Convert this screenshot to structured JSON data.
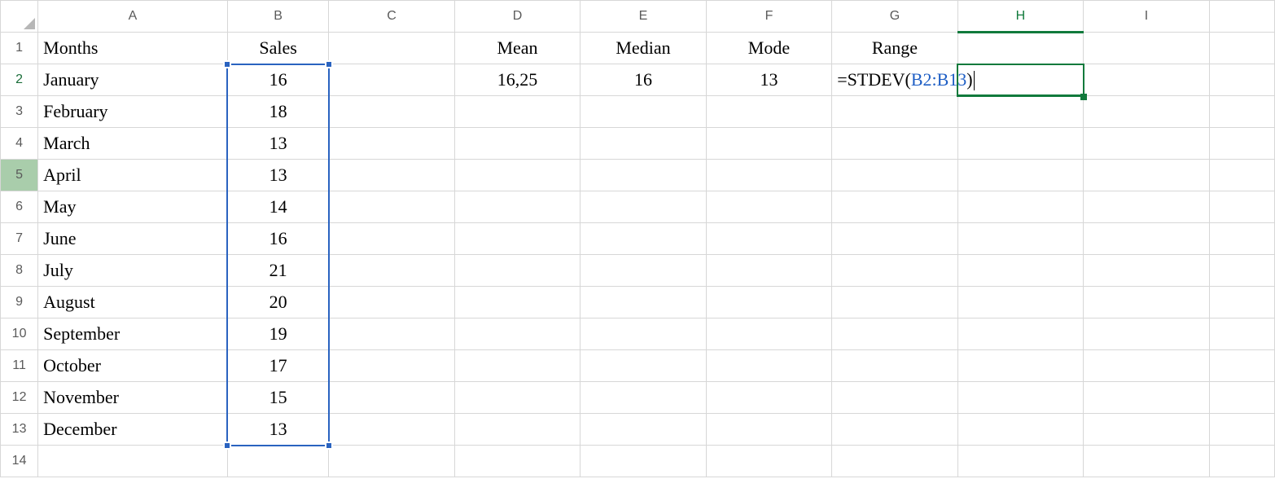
{
  "columns": [
    "A",
    "B",
    "C",
    "D",
    "E",
    "F",
    "G",
    "H",
    "I",
    ""
  ],
  "col_classes": [
    "cA",
    "cB",
    "cC",
    "cD",
    "cE",
    "cF",
    "cG",
    "cH",
    "cI",
    "cJ"
  ],
  "rows": [
    {
      "n": "1",
      "hdr_cls": "",
      "cells": [
        {
          "t": "Months",
          "cls": "left bold"
        },
        {
          "t": "Sales",
          "cls": "center bold"
        },
        {
          "t": "",
          "cls": ""
        },
        {
          "t": "Mean",
          "cls": "center bold"
        },
        {
          "t": "Median",
          "cls": "center bold"
        },
        {
          "t": "Mode",
          "cls": "center bold"
        },
        {
          "t": "Range",
          "cls": "center bold"
        },
        {
          "t": "",
          "cls": ""
        },
        {
          "t": "",
          "cls": ""
        },
        {
          "t": "",
          "cls": ""
        }
      ]
    },
    {
      "n": "2",
      "hdr_cls": "active-row-marker",
      "cells": [
        {
          "t": "January",
          "cls": "left"
        },
        {
          "t": "16",
          "cls": "center range-fill"
        },
        {
          "t": "",
          "cls": ""
        },
        {
          "t": "16,25",
          "cls": "center"
        },
        {
          "t": "16",
          "cls": "center"
        },
        {
          "t": "13",
          "cls": "center"
        },
        {
          "t": "",
          "cls": "",
          "formula": true
        },
        {
          "t": "",
          "cls": ""
        },
        {
          "t": "",
          "cls": ""
        },
        {
          "t": "",
          "cls": ""
        }
      ]
    },
    {
      "n": "3",
      "hdr_cls": "",
      "cells": [
        {
          "t": "February",
          "cls": "left"
        },
        {
          "t": "18",
          "cls": "center range-fill"
        },
        {
          "t": "",
          "cls": ""
        },
        {
          "t": "",
          "cls": ""
        },
        {
          "t": "",
          "cls": ""
        },
        {
          "t": "",
          "cls": ""
        },
        {
          "t": "",
          "cls": ""
        },
        {
          "t": "",
          "cls": ""
        },
        {
          "t": "",
          "cls": ""
        },
        {
          "t": "",
          "cls": ""
        }
      ]
    },
    {
      "n": "4",
      "hdr_cls": "",
      "cells": [
        {
          "t": "March",
          "cls": "left"
        },
        {
          "t": "13",
          "cls": "center range-fill"
        },
        {
          "t": "",
          "cls": ""
        },
        {
          "t": "",
          "cls": ""
        },
        {
          "t": "",
          "cls": ""
        },
        {
          "t": "",
          "cls": ""
        },
        {
          "t": "",
          "cls": ""
        },
        {
          "t": "",
          "cls": ""
        },
        {
          "t": "",
          "cls": ""
        },
        {
          "t": "",
          "cls": ""
        }
      ]
    },
    {
      "n": "5",
      "hdr_cls": "involved",
      "cells": [
        {
          "t": "April",
          "cls": "left"
        },
        {
          "t": "13",
          "cls": "center range-fill"
        },
        {
          "t": "",
          "cls": ""
        },
        {
          "t": "",
          "cls": ""
        },
        {
          "t": "",
          "cls": ""
        },
        {
          "t": "",
          "cls": ""
        },
        {
          "t": "",
          "cls": ""
        },
        {
          "t": "",
          "cls": ""
        },
        {
          "t": "",
          "cls": ""
        },
        {
          "t": "",
          "cls": ""
        }
      ]
    },
    {
      "n": "6",
      "hdr_cls": "",
      "cells": [
        {
          "t": "May",
          "cls": "left"
        },
        {
          "t": "14",
          "cls": "center range-fill"
        },
        {
          "t": "",
          "cls": ""
        },
        {
          "t": "",
          "cls": ""
        },
        {
          "t": "",
          "cls": ""
        },
        {
          "t": "",
          "cls": ""
        },
        {
          "t": "",
          "cls": ""
        },
        {
          "t": "",
          "cls": ""
        },
        {
          "t": "",
          "cls": ""
        },
        {
          "t": "",
          "cls": ""
        }
      ]
    },
    {
      "n": "7",
      "hdr_cls": "",
      "cells": [
        {
          "t": "June",
          "cls": "left"
        },
        {
          "t": "16",
          "cls": "center range-fill"
        },
        {
          "t": "",
          "cls": ""
        },
        {
          "t": "",
          "cls": ""
        },
        {
          "t": "",
          "cls": ""
        },
        {
          "t": "",
          "cls": ""
        },
        {
          "t": "",
          "cls": ""
        },
        {
          "t": "",
          "cls": ""
        },
        {
          "t": "",
          "cls": ""
        },
        {
          "t": "",
          "cls": ""
        }
      ]
    },
    {
      "n": "8",
      "hdr_cls": "",
      "cells": [
        {
          "t": "July",
          "cls": "left"
        },
        {
          "t": "21",
          "cls": "center range-fill"
        },
        {
          "t": "",
          "cls": ""
        },
        {
          "t": "",
          "cls": ""
        },
        {
          "t": "",
          "cls": ""
        },
        {
          "t": "",
          "cls": ""
        },
        {
          "t": "",
          "cls": ""
        },
        {
          "t": "",
          "cls": ""
        },
        {
          "t": "",
          "cls": ""
        },
        {
          "t": "",
          "cls": ""
        }
      ]
    },
    {
      "n": "9",
      "hdr_cls": "",
      "cells": [
        {
          "t": "August",
          "cls": "left"
        },
        {
          "t": "20",
          "cls": "center range-fill"
        },
        {
          "t": "",
          "cls": ""
        },
        {
          "t": "",
          "cls": ""
        },
        {
          "t": "",
          "cls": ""
        },
        {
          "t": "",
          "cls": ""
        },
        {
          "t": "",
          "cls": ""
        },
        {
          "t": "",
          "cls": ""
        },
        {
          "t": "",
          "cls": ""
        },
        {
          "t": "",
          "cls": ""
        }
      ]
    },
    {
      "n": "10",
      "hdr_cls": "",
      "cells": [
        {
          "t": "September",
          "cls": "left"
        },
        {
          "t": "19",
          "cls": "center range-fill"
        },
        {
          "t": "",
          "cls": ""
        },
        {
          "t": "",
          "cls": ""
        },
        {
          "t": "",
          "cls": ""
        },
        {
          "t": "",
          "cls": ""
        },
        {
          "t": "",
          "cls": ""
        },
        {
          "t": "",
          "cls": ""
        },
        {
          "t": "",
          "cls": ""
        },
        {
          "t": "",
          "cls": ""
        }
      ]
    },
    {
      "n": "11",
      "hdr_cls": "",
      "cells": [
        {
          "t": "October",
          "cls": "left"
        },
        {
          "t": "17",
          "cls": "center range-fill"
        },
        {
          "t": "",
          "cls": ""
        },
        {
          "t": "",
          "cls": ""
        },
        {
          "t": "",
          "cls": ""
        },
        {
          "t": "",
          "cls": ""
        },
        {
          "t": "",
          "cls": ""
        },
        {
          "t": "",
          "cls": ""
        },
        {
          "t": "",
          "cls": ""
        },
        {
          "t": "",
          "cls": ""
        }
      ]
    },
    {
      "n": "12",
      "hdr_cls": "",
      "cells": [
        {
          "t": "November",
          "cls": "left"
        },
        {
          "t": "15",
          "cls": "center range-fill"
        },
        {
          "t": "",
          "cls": ""
        },
        {
          "t": "",
          "cls": ""
        },
        {
          "t": "",
          "cls": ""
        },
        {
          "t": "",
          "cls": ""
        },
        {
          "t": "",
          "cls": ""
        },
        {
          "t": "",
          "cls": ""
        },
        {
          "t": "",
          "cls": ""
        },
        {
          "t": "",
          "cls": ""
        }
      ]
    },
    {
      "n": "13",
      "hdr_cls": "",
      "cells": [
        {
          "t": "December",
          "cls": "left"
        },
        {
          "t": "13",
          "cls": "center range-fill"
        },
        {
          "t": "",
          "cls": ""
        },
        {
          "t": "",
          "cls": ""
        },
        {
          "t": "",
          "cls": ""
        },
        {
          "t": "",
          "cls": ""
        },
        {
          "t": "",
          "cls": ""
        },
        {
          "t": "",
          "cls": ""
        },
        {
          "t": "",
          "cls": ""
        },
        {
          "t": "",
          "cls": ""
        }
      ]
    },
    {
      "n": "14",
      "hdr_cls": "",
      "cells": [
        {
          "t": "",
          "cls": ""
        },
        {
          "t": "",
          "cls": ""
        },
        {
          "t": "",
          "cls": ""
        },
        {
          "t": "",
          "cls": ""
        },
        {
          "t": "",
          "cls": ""
        },
        {
          "t": "",
          "cls": ""
        },
        {
          "t": "",
          "cls": ""
        },
        {
          "t": "",
          "cls": ""
        },
        {
          "t": "",
          "cls": ""
        },
        {
          "t": "",
          "cls": ""
        }
      ]
    }
  ],
  "formula": {
    "prefix": "=STDEV(",
    "ref": "B2:B13",
    "suffix": ")"
  },
  "active_cell": "H2",
  "active_column_letter": "H",
  "selected_range": "B2:B13",
  "chart_data": null
}
